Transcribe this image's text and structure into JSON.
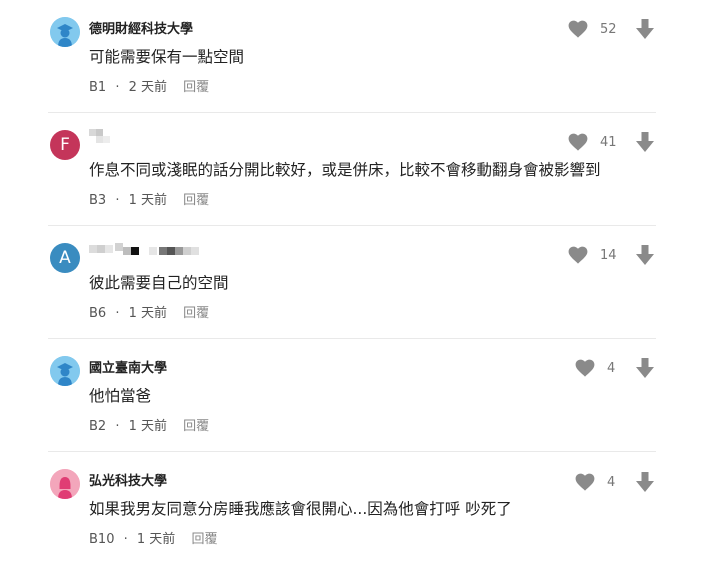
{
  "comments": [
    {
      "author": "德明財經科技大學",
      "avatar_type": "student-silhouette-blue",
      "text": "可能需要保有一點空間",
      "floor": "B1",
      "time": "2 天前",
      "reply_label": "回覆",
      "likes": "52"
    },
    {
      "author": "",
      "author_hidden": true,
      "avatar_letter": "F",
      "avatar_color": "#c4355a",
      "text": "作息不同或淺眠的話分開比較好，或是併床，比較不會移動翻身會被影響到",
      "floor": "B3",
      "time": "1 天前",
      "reply_label": "回覆",
      "likes": "41"
    },
    {
      "author": "",
      "author_hidden": true,
      "avatar_letter": "A",
      "avatar_color": "#3a8cc0",
      "text": "彼此需要自己的空間",
      "floor": "B6",
      "time": "1 天前",
      "reply_label": "回覆",
      "likes": "14"
    },
    {
      "author": "國立臺南大學",
      "avatar_type": "student-silhouette-blue",
      "text": "他怕當爸",
      "floor": "B2",
      "time": "1 天前",
      "reply_label": "回覆",
      "likes": "4"
    },
    {
      "author": "弘光科技大學",
      "avatar_type": "student-silhouette-pink",
      "text": "如果我男友同意分房睡我應該會很開心...因為他會打呼 吵死了",
      "floor": "B10",
      "time": "1 天前",
      "reply_label": "回覆",
      "likes": "4"
    }
  ],
  "separator": "·",
  "colors": {
    "avatar_blue": "#82c9ee",
    "avatar_blue_figure": "#2f86c8",
    "avatar_pink": "#f3a6bb",
    "avatar_pink_figure": "#e03d74",
    "icon_gray": "#8a8a8a"
  },
  "icons": [
    "heart-icon",
    "thumbs-down-arrow-icon"
  ]
}
